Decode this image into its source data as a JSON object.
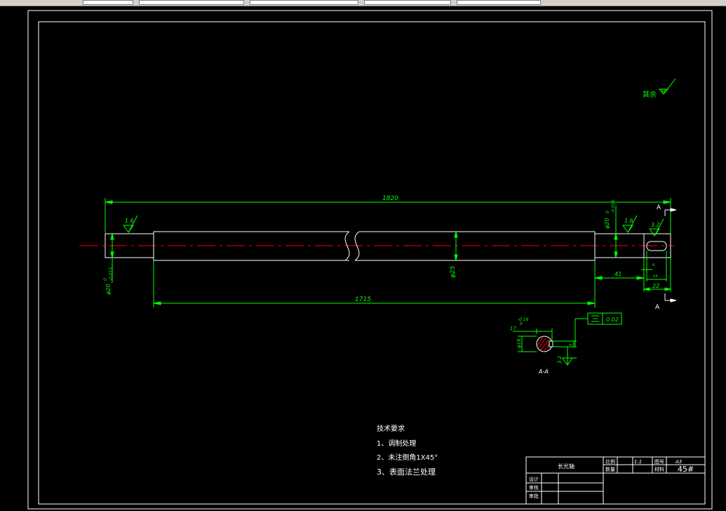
{
  "colors": {
    "background": "#000000",
    "outline": "#ffffff",
    "dimension": "#00ff00",
    "centerline": "#ff0000",
    "toolbar": "#d4d0c8"
  },
  "surface_note": {
    "text": "其余"
  },
  "dimensions": {
    "overall_length": "1820",
    "shaft_length": "1715",
    "left_diameter": "φ20",
    "left_tol_upper": "0",
    "left_tol_lower": "-0.015",
    "right_diameter": "φ20",
    "right_tol_upper": "0",
    "right_tol_lower": "-0.015",
    "main_diameter": "φ25",
    "right_step": "41",
    "keyway_length": "22",
    "keyway_small_1": "6",
    "keyway_small_2": "14"
  },
  "roughness": {
    "left": "1.6",
    "right": "1.6",
    "end": "3.2",
    "section": "3.2"
  },
  "section": {
    "cut_label_top": "A",
    "cut_label_bottom": "A",
    "title": "A-A",
    "key_depth": "17",
    "key_depth_tol_upper": "0",
    "key_depth_tol_lower": "-0.16",
    "diameter": "φ16",
    "key_width": "5",
    "flatness_symbol": "=",
    "flatness_value": "0.02"
  },
  "tech_requirements": {
    "heading": "技术要求",
    "item1": "1、调制处理",
    "item2": "2、未注倒角1X45°",
    "item3": "3、表面法兰处理"
  },
  "title_block": {
    "part_name": "长光轴",
    "scale_label": "比例",
    "scale_value": "1:1",
    "drawing_no_label": "图号",
    "drawing_no_value": "A3",
    "quantity_label": "数量",
    "material_label": "材料",
    "material_value": "45#",
    "designer_label": "设计",
    "checker_label": "审核",
    "approver_label": "审批"
  }
}
